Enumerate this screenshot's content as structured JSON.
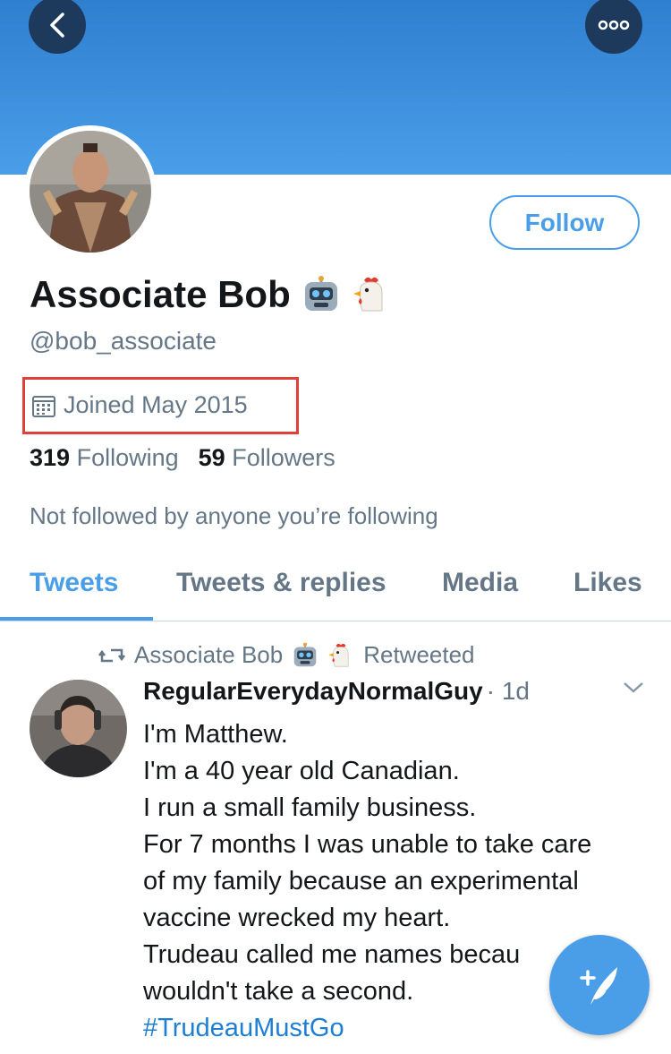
{
  "profile": {
    "display_name": "Associate Bob",
    "name_emojis": [
      "robot-emoji",
      "chicken-emoji"
    ],
    "handle": "@bob_associate",
    "joined": "Joined May 2015",
    "following_count": "319",
    "following_label": "Following",
    "followers_count": "59",
    "followers_label": "Followers",
    "not_followed_text": "Not followed by anyone you’re following",
    "follow_label": "Follow"
  },
  "tabs": [
    {
      "label": "Tweets",
      "active": true
    },
    {
      "label": "Tweets & replies",
      "active": false
    },
    {
      "label": "Media",
      "active": false
    },
    {
      "label": "Likes",
      "active": false
    }
  ],
  "tweet": {
    "retweeter": "Associate Bob",
    "retweeted_label": "Retweeted",
    "author": "RegularEverydayNormalGuy",
    "time": "· 1d",
    "lines": [
      "I'm Matthew.",
      "I'm a 40 year old Canadian.",
      "I run a small family business.",
      "For 7 months I was unable to take care",
      "of my family because an experimental",
      "vaccine wrecked my heart.",
      "Trudeau called me names becau",
      "wouldn't take a second."
    ],
    "hashtag": "#TrudeauMustGo"
  },
  "colors": {
    "accent": "#4a9ee8",
    "banner": "#3b8fe0",
    "highlight_box": "#e0403a",
    "secondary_text": "#657786"
  }
}
